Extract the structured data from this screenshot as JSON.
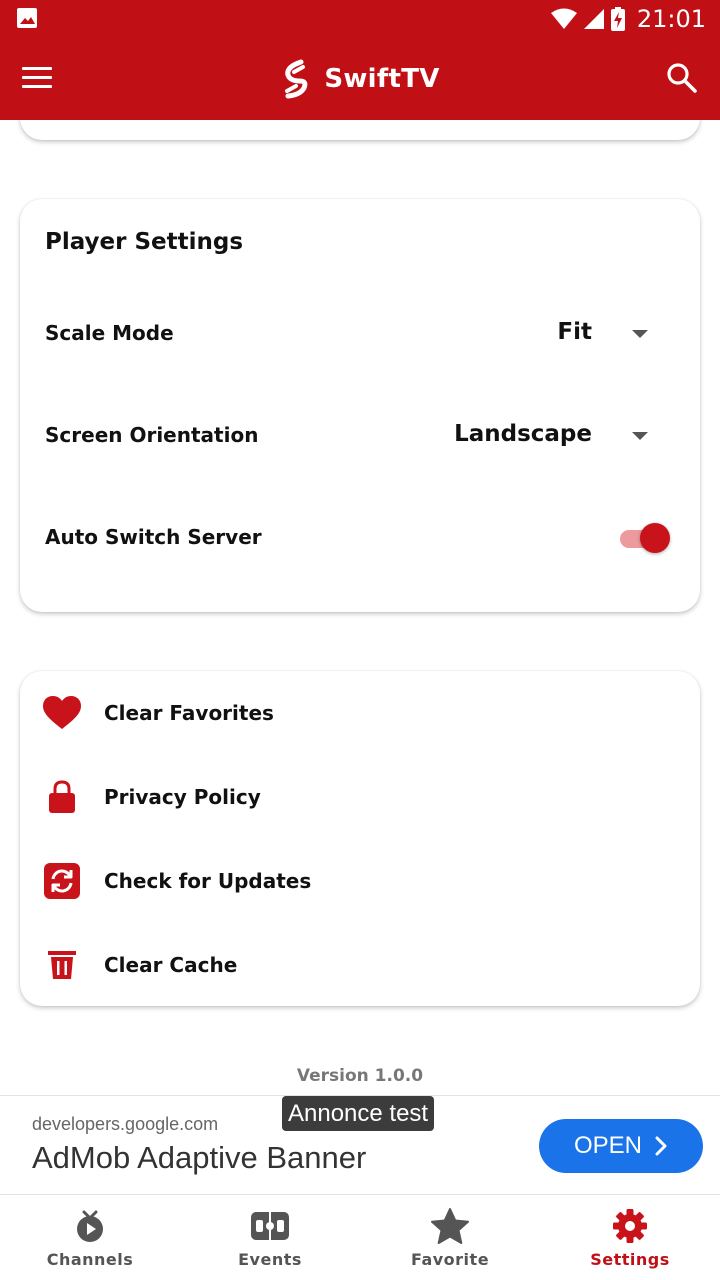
{
  "status_bar": {
    "time": "21:01"
  },
  "app_bar": {
    "title": "SwiftTV",
    "icons": [
      "menu-icon",
      "swifttv-logo",
      "search-icon"
    ]
  },
  "player_settings": {
    "title": "Player Settings",
    "scale_mode": {
      "label": "Scale Mode",
      "value": "Fit"
    },
    "screen_orientation": {
      "label": "Screen Orientation",
      "value": "Landscape"
    },
    "auto_switch_server": {
      "label": "Auto Switch Server",
      "enabled": true
    }
  },
  "actions": [
    {
      "label": "Clear Favorites",
      "icon": "heart-icon"
    },
    {
      "label": "Privacy Policy",
      "icon": "lock-icon"
    },
    {
      "label": "Check for Updates",
      "icon": "refresh-icon"
    },
    {
      "label": "Clear Cache",
      "icon": "trash-icon"
    }
  ],
  "version": "Version 1.0.0",
  "ad": {
    "tag": "Annonce test",
    "domain": "developers.google.com",
    "title": "AdMob Adaptive Banner",
    "cta": "OPEN"
  },
  "bottom_nav": {
    "items": [
      {
        "label": "Channels",
        "icon": "tv-icon",
        "active": false
      },
      {
        "label": "Events",
        "icon": "scoreboard-icon",
        "active": false
      },
      {
        "label": "Favorite",
        "icon": "star-icon",
        "active": false
      },
      {
        "label": "Settings",
        "icon": "gear-icon",
        "active": true
      }
    ]
  },
  "colors": {
    "brand": "#c01016",
    "accent": "#c8131a",
    "ad_button": "#1a73e8"
  }
}
